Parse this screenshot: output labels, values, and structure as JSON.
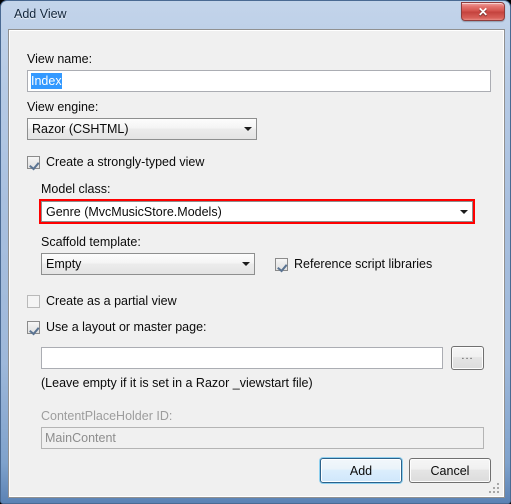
{
  "window": {
    "title": "Add View",
    "close_icon": "close-icon",
    "close_glyph": "✕"
  },
  "form": {
    "view_name_label": "View name:",
    "view_name_value": "Index",
    "view_engine_label": "View engine:",
    "view_engine_value": "Razor (CSHTML)",
    "strongly_typed_label": "Create a strongly-typed view",
    "strongly_typed_checked": true,
    "model_class_label": "Model class:",
    "model_class_value": "Genre (MvcMusicStore.Models)",
    "scaffold_label": "Scaffold template:",
    "scaffold_value": "Empty",
    "reference_scripts_label": "Reference script libraries",
    "reference_scripts_checked": true,
    "partial_view_label": "Create as a partial view",
    "partial_view_checked": false,
    "layout_label": "Use a layout or master page:",
    "layout_checked": true,
    "layout_path_value": "",
    "layout_path_placeholder": "",
    "browse_label": "...",
    "layout_hint": "(Leave empty if it is set in a Razor _viewstart file)",
    "placeholder_id_label": "ContentPlaceHolder ID:",
    "placeholder_id_value": "MainContent"
  },
  "buttons": {
    "add_label": "Add",
    "cancel_label": "Cancel"
  },
  "colors": {
    "annotation": "#ff0000",
    "selection": "#3399ff",
    "title_bar_accent": "#a9c0df",
    "close_button": "#d1504a"
  }
}
